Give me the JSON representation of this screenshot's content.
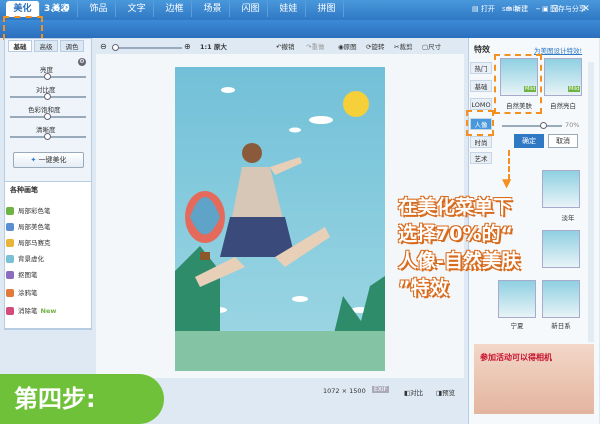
{
  "app": {
    "title": "3.6.0",
    "user": "smile"
  },
  "menu_tabs": [
    "美化",
    "美容",
    "饰品",
    "文字",
    "边框",
    "场景",
    "闪图",
    "娃娃",
    "拼图"
  ],
  "top_actions": {
    "open": "打开",
    "new": "新建",
    "save_share": "保存与分享"
  },
  "left_panel": {
    "subtabs": [
      "基础",
      "高级",
      "调色"
    ],
    "sliders": [
      {
        "label": "亮度",
        "value": 0.5
      },
      {
        "label": "对比度",
        "value": 0.5
      },
      {
        "label": "色彩饱和度",
        "value": 0.5
      },
      {
        "label": "清晰度",
        "value": 0.5
      }
    ],
    "one_click_label": "一键美化",
    "brush_title": "各种画笔",
    "brushes": [
      {
        "label": "局部彩色笔",
        "color": "#6fb344"
      },
      {
        "label": "局部美色笔",
        "color": "#5a8fd6"
      },
      {
        "label": "局部马赛克",
        "color": "#e8b43a"
      },
      {
        "label": "背景虚化",
        "color": "#7ac1d8"
      },
      {
        "label": "抠图笔",
        "color": "#8c6bbf"
      },
      {
        "label": "涂鸦笔",
        "color": "#e27a3a"
      },
      {
        "label": "消除笔",
        "color": "#d24b7a",
        "badge": "New"
      }
    ]
  },
  "toolbar": {
    "zoom_ratio": "1:1",
    "fit_label": "原大",
    "undo": "撤销",
    "redo": "重做",
    "original": "原图",
    "rotate": "旋转",
    "crop": "裁剪",
    "size": "尺寸"
  },
  "bottom_bar": {
    "dimensions_w": "1072",
    "dimensions_sep": "×",
    "dimensions_h": "1500",
    "exif": "EXIF",
    "compare": "对比",
    "preview": "预览"
  },
  "right_panel": {
    "title": "特效",
    "design_link": "为美图设计特效!",
    "categories": [
      "热门",
      "基础",
      "LOMO",
      "人像",
      "时尚",
      "艺术"
    ],
    "active_category": "人像",
    "effects": [
      {
        "label": "自然美肤",
        "badge": "Mild"
      },
      {
        "label": "自然亮白",
        "badge": "Mild"
      }
    ],
    "opacity": "70%",
    "confirm": "确定",
    "cancel": "取消",
    "more_effects": [
      {
        "label": "宁夏"
      },
      {
        "label": "新日系"
      }
    ],
    "side_label": "淡年"
  },
  "annotation": {
    "lines": [
      "在美化菜单下",
      "选择70%的“",
      "人像-自然美肤",
      "”特效"
    ]
  },
  "step": {
    "label": "第四步:"
  },
  "ad": {
    "text": "参加活动可以得相机"
  },
  "colors": {
    "accent": "#2f78c4",
    "annotation_stroke": "#d86a1c",
    "step_bg": "#6fc13a",
    "dash": "#f5901e"
  }
}
